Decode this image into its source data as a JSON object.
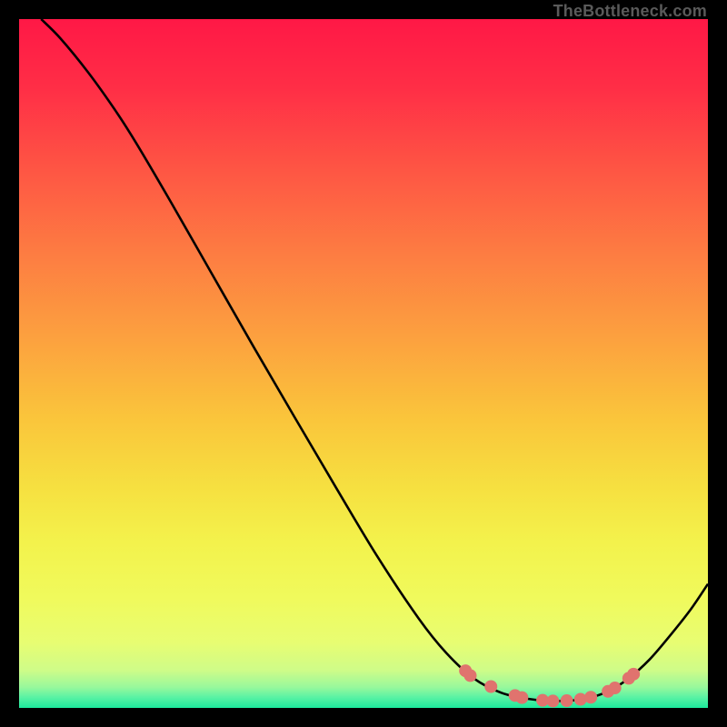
{
  "watermark": "TheBottleneck.com",
  "chart_data": {
    "type": "line",
    "title": "",
    "xlabel": "",
    "ylabel": "",
    "xlim": [
      0,
      100
    ],
    "ylim": [
      0,
      100
    ],
    "series": [
      {
        "name": "bottleneck-curve",
        "color": "#000000",
        "stroke_width": 2.6,
        "points": [
          {
            "x": 3.2,
            "y": 100.0
          },
          {
            "x": 6.0,
            "y": 97.2
          },
          {
            "x": 10.0,
            "y": 92.3
          },
          {
            "x": 14.0,
            "y": 86.7
          },
          {
            "x": 17.0,
            "y": 82.0
          },
          {
            "x": 22.0,
            "y": 73.5
          },
          {
            "x": 28.0,
            "y": 63.0
          },
          {
            "x": 34.0,
            "y": 52.5
          },
          {
            "x": 40.0,
            "y": 42.2
          },
          {
            "x": 46.0,
            "y": 32.0
          },
          {
            "x": 52.0,
            "y": 22.0
          },
          {
            "x": 58.0,
            "y": 13.0
          },
          {
            "x": 62.0,
            "y": 8.0
          },
          {
            "x": 66.0,
            "y": 4.3
          },
          {
            "x": 70.0,
            "y": 2.2
          },
          {
            "x": 74.0,
            "y": 1.3
          },
          {
            "x": 78.0,
            "y": 1.0
          },
          {
            "x": 82.0,
            "y": 1.3
          },
          {
            "x": 85.5,
            "y": 2.4
          },
          {
            "x": 88.5,
            "y": 4.3
          },
          {
            "x": 91.5,
            "y": 7.0
          },
          {
            "x": 94.5,
            "y": 10.5
          },
          {
            "x": 97.5,
            "y": 14.3
          },
          {
            "x": 100.0,
            "y": 18.0
          }
        ]
      }
    ],
    "markers": {
      "name": "highlight-dots",
      "color": "#E0736E",
      "radius": 7,
      "points": [
        {
          "x": 64.8,
          "y": 5.4
        },
        {
          "x": 65.5,
          "y": 4.7
        },
        {
          "x": 68.5,
          "y": 3.1
        },
        {
          "x": 72.0,
          "y": 1.8
        },
        {
          "x": 73.0,
          "y": 1.5
        },
        {
          "x": 76.0,
          "y": 1.1
        },
        {
          "x": 77.5,
          "y": 1.0
        },
        {
          "x": 79.5,
          "y": 1.05
        },
        {
          "x": 81.5,
          "y": 1.25
        },
        {
          "x": 83.0,
          "y": 1.55
        },
        {
          "x": 85.5,
          "y": 2.4
        },
        {
          "x": 86.5,
          "y": 2.9
        },
        {
          "x": 88.5,
          "y": 4.3
        },
        {
          "x": 89.2,
          "y": 4.9
        }
      ]
    },
    "background_gradient": {
      "stops": [
        {
          "offset": 0.0,
          "color": "#FF1846"
        },
        {
          "offset": 0.1,
          "color": "#FF2E46"
        },
        {
          "offset": 0.22,
          "color": "#FE5644"
        },
        {
          "offset": 0.34,
          "color": "#FD7C42"
        },
        {
          "offset": 0.46,
          "color": "#FCA03F"
        },
        {
          "offset": 0.58,
          "color": "#FAC53B"
        },
        {
          "offset": 0.68,
          "color": "#F6E040"
        },
        {
          "offset": 0.76,
          "color": "#F3F24C"
        },
        {
          "offset": 0.84,
          "color": "#F0FA5C"
        },
        {
          "offset": 0.905,
          "color": "#E8FD72"
        },
        {
          "offset": 0.945,
          "color": "#CFFC88"
        },
        {
          "offset": 0.97,
          "color": "#98F89C"
        },
        {
          "offset": 0.985,
          "color": "#58F2A4"
        },
        {
          "offset": 1.0,
          "color": "#1CE99C"
        }
      ]
    }
  }
}
